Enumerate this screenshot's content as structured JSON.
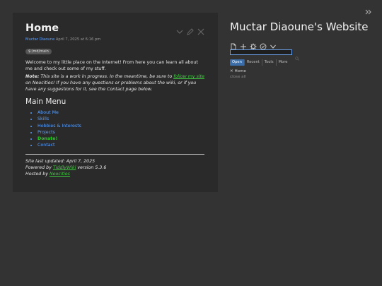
{
  "tiddler": {
    "title": "Home",
    "meta_author": "Muctar Diaoune",
    "meta_date": "April 7, 2025 at 6:16 pm",
    "tag": "$:/md/main",
    "intro": "Welcome to my little place on the Internet! From here you can learn all about me and check out some of my stuff.",
    "note_label": "Note:",
    "note_text_1": " This site is a work in progress. In the meantime, be sure to ",
    "note_link": "follow my site",
    "note_text_2": " on Neocities! If you have any questions or problems about the wiki, or if you have any suggestions for it, see the Contact page below.",
    "main_menu_heading": "Main Menu",
    "menu_items": [
      "About Me",
      "Skills",
      "Hobbies & Interests",
      "Projects",
      "Donate!",
      "Contact"
    ],
    "footer_updated": "Site last updated: April 7, 2025",
    "footer_powered_prefix": "Powered by ",
    "footer_powered_link": "TiddlyWiki",
    "footer_powered_suffix": " version 5.3.6",
    "footer_hosted_prefix": "Hosted by ",
    "footer_hosted_link": "Neocities"
  },
  "sidebar": {
    "site_title": "Muctar Diaoune's Website",
    "search_value": "",
    "tabs": [
      "Open",
      "Recent",
      "Tools",
      "More"
    ],
    "active_tab": "Open",
    "open_items": [
      "Home"
    ],
    "close_all": "close all"
  },
  "icons": {
    "tiddler_controls": [
      "chevron-down-icon",
      "edit-icon",
      "close-icon"
    ],
    "sidebar_actions": [
      "new-tiddler-icon",
      "plus-icon",
      "gear-icon",
      "check-circle-icon",
      "chevron-down-icon"
    ],
    "search": "search-icon",
    "corner": "double-chevron-right-icon"
  },
  "colors": {
    "background": "#333333",
    "tiddler_bg": "#2a2a2a",
    "link": "#5aa0ff",
    "external_link": "#3ecf3e",
    "donate": "#20d020",
    "active_tab": "#3b6ea8"
  }
}
